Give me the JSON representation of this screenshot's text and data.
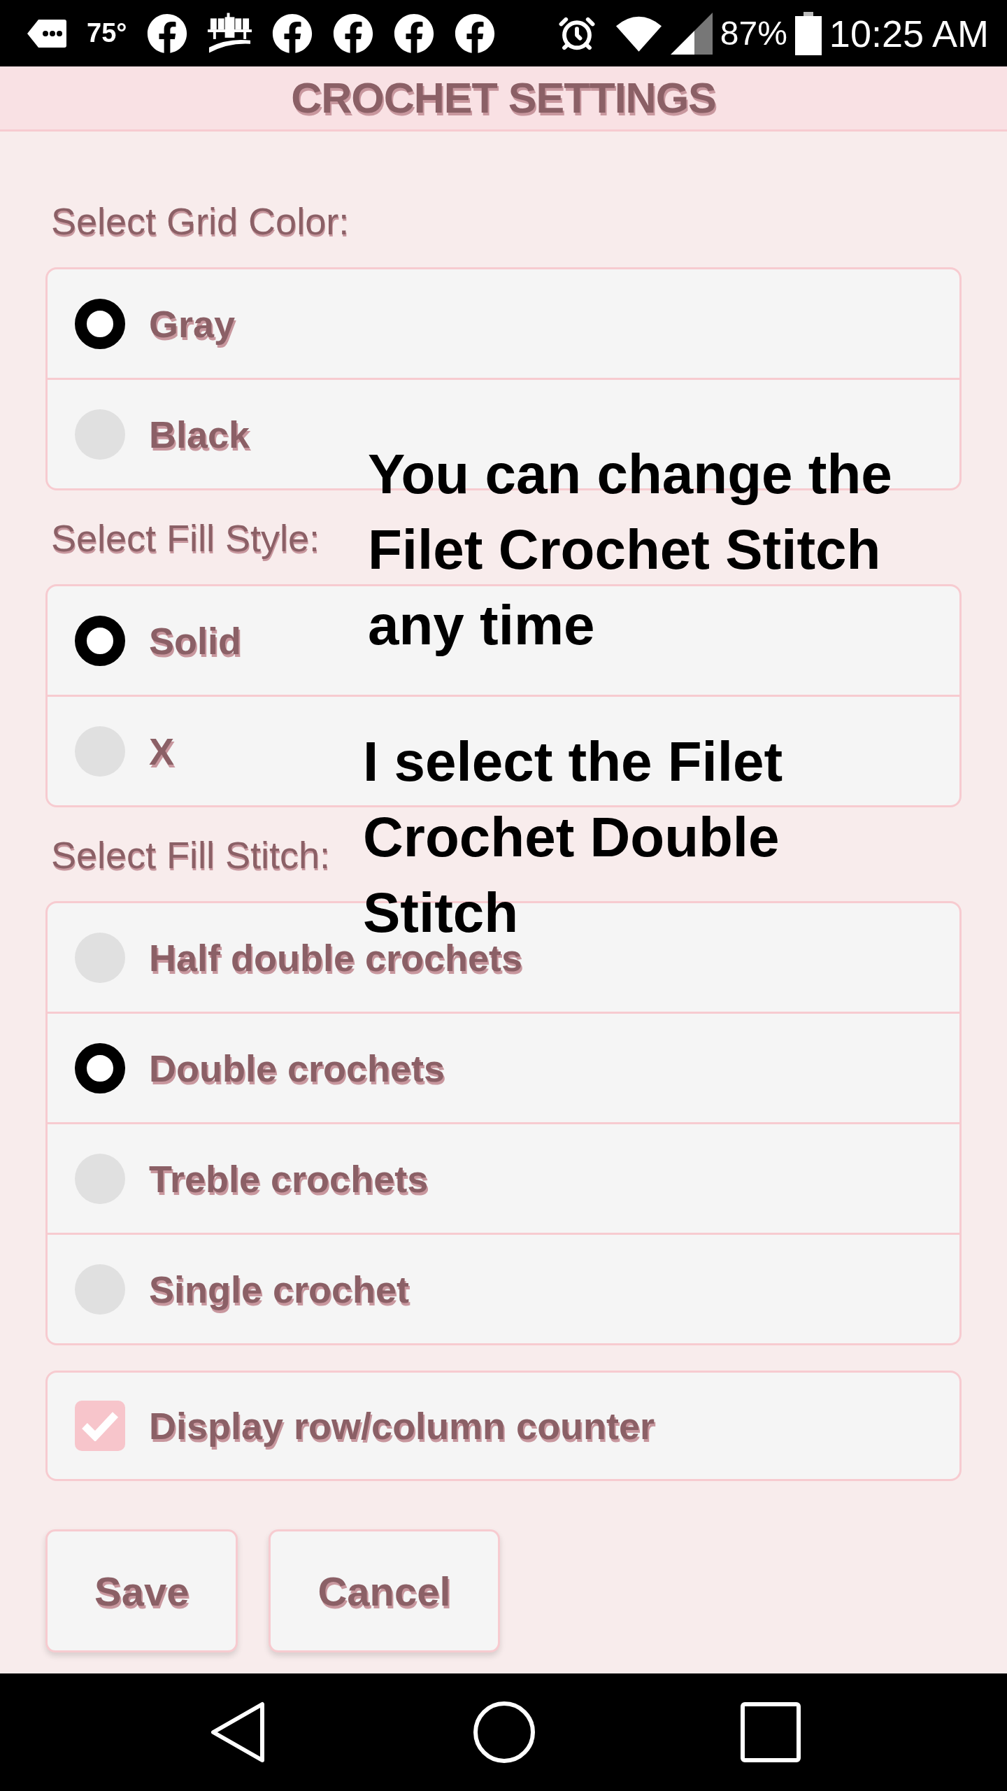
{
  "status_bar": {
    "temperature": "75°",
    "battery": "87%",
    "time": "10:25 AM"
  },
  "title": "CROCHET SETTINGS",
  "sections": [
    {
      "label": "Select Grid Color:",
      "options": [
        {
          "label": "Gray",
          "selected": true
        },
        {
          "label": "Black",
          "selected": false
        }
      ]
    },
    {
      "label": "Select Fill Style:",
      "options": [
        {
          "label": "Solid",
          "selected": true
        },
        {
          "label": "X",
          "selected": false
        }
      ]
    },
    {
      "label": "Select Fill Stitch:",
      "options": [
        {
          "label": "Half double crochets",
          "selected": false
        },
        {
          "label": "Double crochets",
          "selected": true
        },
        {
          "label": "Treble crochets",
          "selected": false
        },
        {
          "label": "Single crochet",
          "selected": false
        }
      ]
    }
  ],
  "counter_option": {
    "label": "Display row/column counter",
    "checked": true
  },
  "buttons": [
    "Save",
    "Cancel"
  ],
  "annotations": [
    "You can change the Filet Crochet Stitch any time",
    "I select the Filet Crochet Double Stitch"
  ]
}
